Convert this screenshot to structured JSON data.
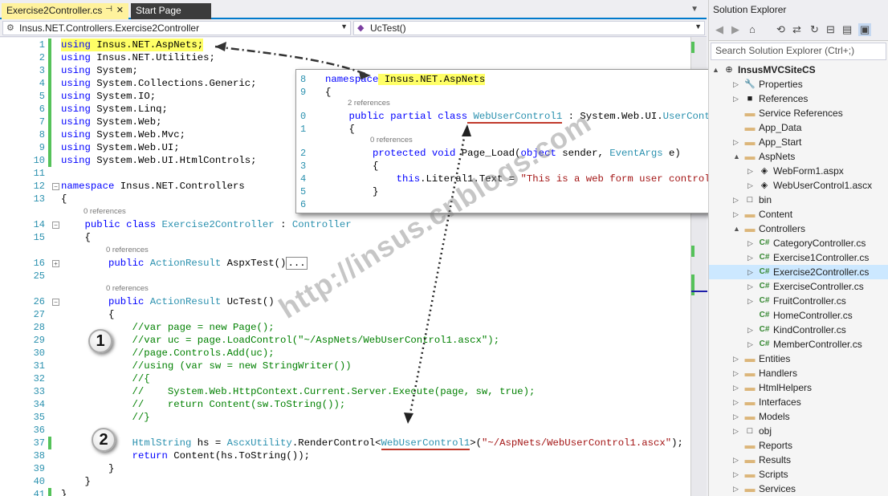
{
  "tabs": [
    {
      "label": "Exercise2Controller.cs",
      "pinned": "⊣",
      "close": "✕"
    },
    {
      "label": "Start Page"
    }
  ],
  "nav": {
    "left": "Insus.NET.Controllers.Exercise2Controller",
    "right": "UcTest()"
  },
  "code_lines": [
    {
      "n": "1",
      "t": [
        [
          "kw",
          "using"
        ],
        [
          "",
          "Insus.NET.AspNets;"
        ]
      ],
      "hl": true,
      "chg": true
    },
    {
      "n": "2",
      "t": [
        [
          "kw",
          "using"
        ],
        [
          "",
          "Insus.NET.Utilities;"
        ]
      ],
      "chg": true
    },
    {
      "n": "3",
      "t": [
        [
          "kw",
          "using"
        ],
        [
          "",
          "System;"
        ]
      ],
      "chg": true
    },
    {
      "n": "4",
      "t": [
        [
          "kw",
          "using"
        ],
        [
          "",
          "System.Collections.Generic;"
        ]
      ],
      "chg": true
    },
    {
      "n": "5",
      "t": [
        [
          "kw",
          "using"
        ],
        [
          "",
          "System.IO;"
        ]
      ],
      "chg": true
    },
    {
      "n": "6",
      "t": [
        [
          "kw",
          "using"
        ],
        [
          "",
          "System.Linq;"
        ]
      ],
      "chg": true
    },
    {
      "n": "7",
      "t": [
        [
          "kw",
          "using"
        ],
        [
          "",
          "System.Web;"
        ]
      ],
      "chg": true
    },
    {
      "n": "8",
      "t": [
        [
          "kw",
          "using"
        ],
        [
          "",
          "System.Web.Mvc;"
        ]
      ],
      "chg": true
    },
    {
      "n": "9",
      "t": [
        [
          "kw",
          "using"
        ],
        [
          "",
          "System.Web.UI;"
        ]
      ],
      "chg": true
    },
    {
      "n": "10",
      "t": [
        [
          "kw",
          "using"
        ],
        [
          "",
          "System.Web.UI.HtmlControls;"
        ]
      ],
      "chg": true
    },
    {
      "n": "11",
      "t": []
    },
    {
      "n": "12",
      "t": [
        [
          "kw",
          "namespace"
        ],
        [
          "",
          "Insus.NET.Controllers"
        ]
      ]
    },
    {
      "n": "13",
      "t": [
        [
          "",
          "{"
        ]
      ]
    },
    {
      "n": "14",
      "t": [
        [
          "",
          "    "
        ],
        [
          "kw",
          "public class"
        ],
        [
          "ty",
          "Exercise2Controller"
        ],
        [
          "",
          " : "
        ],
        [
          "ty",
          "Controller"
        ]
      ]
    },
    {
      "n": "15",
      "t": [
        [
          "",
          "    {"
        ]
      ]
    },
    {
      "n": "16",
      "t": [
        [
          "",
          "        "
        ],
        [
          "kw",
          "public"
        ],
        [
          "ty",
          "ActionResult"
        ],
        [
          "",
          "AspxTest()"
        ],
        [
          "box",
          "..."
        ]
      ]
    },
    {
      "n": "25",
      "t": []
    },
    {
      "n": "26",
      "t": [
        [
          "",
          "        "
        ],
        [
          "kw",
          "public"
        ],
        [
          "ty",
          "ActionResult"
        ],
        [
          "",
          "UcTest()"
        ]
      ]
    },
    {
      "n": "27",
      "t": [
        [
          "",
          "        {"
        ]
      ]
    },
    {
      "n": "28",
      "t": [
        [
          "cm",
          "            //var page = new Page();"
        ]
      ]
    },
    {
      "n": "29",
      "t": [
        [
          "cm",
          "            //var uc = page.LoadControl(\"~/AspNets/WebUserControl1.ascx\");"
        ]
      ]
    },
    {
      "n": "30",
      "t": [
        [
          "cm",
          "            //page.Controls.Add(uc);"
        ]
      ]
    },
    {
      "n": "31",
      "t": [
        [
          "cm",
          "            //using (var sw = new StringWriter())"
        ]
      ]
    },
    {
      "n": "32",
      "t": [
        [
          "cm",
          "            //{"
        ]
      ]
    },
    {
      "n": "33",
      "t": [
        [
          "cm",
          "            //    System.Web.HttpContext.Current.Server.Execute(page, sw, true);"
        ]
      ]
    },
    {
      "n": "34",
      "t": [
        [
          "cm",
          "            //    return Content(sw.ToString());"
        ]
      ]
    },
    {
      "n": "35",
      "t": [
        [
          "cm",
          "            //}"
        ]
      ]
    },
    {
      "n": "36",
      "t": []
    },
    {
      "n": "37",
      "t": [
        [
          "",
          "            "
        ],
        [
          "ty",
          "HtmlString"
        ],
        [
          "",
          " hs = "
        ],
        [
          "ty",
          "AscxUtility"
        ],
        [
          "",
          ".RenderControl<"
        ],
        [
          "tyu",
          "WebUserControl1"
        ],
        [
          "",
          ">("
        ],
        [
          "st",
          "\"~/AspNets/WebUserControl1.ascx\""
        ],
        [
          "",
          ");"
        ]
      ],
      "chg": true
    },
    {
      "n": "38",
      "t": [
        [
          "",
          "            "
        ],
        [
          "kw",
          "return"
        ],
        [
          "",
          " Content(hs.ToString());"
        ]
      ]
    },
    {
      "n": "39",
      "t": [
        [
          "",
          "        }"
        ]
      ]
    },
    {
      "n": "40",
      "t": [
        [
          "",
          "    }"
        ]
      ]
    },
    {
      "n": "41",
      "t": [
        [
          "",
          "}"
        ]
      ],
      "chg": true
    }
  ],
  "refs": {
    "r14": "0 references",
    "r16": "0 references",
    "r26": "0 references"
  },
  "popup": {
    "lines": [
      {
        "n": "8",
        "t": [
          [
            "kw",
            "namespace"
          ],
          [
            "hl",
            "Insus.NET.AspNets"
          ]
        ]
      },
      {
        "n": "9",
        "t": [
          [
            "",
            "{"
          ]
        ]
      },
      {
        "n": "0",
        "t": [
          [
            "",
            "    "
          ],
          [
            "kw",
            "public partial class"
          ],
          [
            "tyu",
            "WebUserControl1"
          ],
          [
            "",
            " : System.Web.UI."
          ],
          [
            "ty",
            "UserControl"
          ]
        ]
      },
      {
        "n": "1",
        "t": [
          [
            "",
            "    {"
          ]
        ]
      },
      {
        "n": "2",
        "t": [
          [
            "",
            "        "
          ],
          [
            "kw",
            "protected void"
          ],
          [
            "",
            "Page_Load("
          ],
          [
            "kw",
            "object"
          ],
          [
            "",
            " sender, "
          ],
          [
            "ty",
            "EventArgs"
          ],
          [
            "",
            " e)"
          ]
        ]
      },
      {
        "n": "3",
        "t": [
          [
            "",
            "        {"
          ]
        ]
      },
      {
        "n": "4",
        "t": [
          [
            "",
            "            "
          ],
          [
            "kw",
            "this"
          ],
          [
            "",
            ".Literal1.Text = "
          ],
          [
            "st",
            "\"This is a web form user control.\""
          ],
          [
            "",
            ";"
          ]
        ]
      },
      {
        "n": "5",
        "t": [
          [
            "",
            "        }"
          ]
        ]
      },
      {
        "n": "6",
        "t": []
      }
    ],
    "ref1": "2 references",
    "ref2": "0 references"
  },
  "watermark": "http://insus.cnblogs.com",
  "badges": [
    "1",
    "2"
  ],
  "solution_explorer": {
    "title": "Solution Explorer",
    "search_placeholder": "Search Solution Explorer (Ctrl+;)",
    "items": [
      {
        "label": "InsusMVCSiteCS",
        "depth": 0,
        "arrow": "▲",
        "icon": "⊕",
        "bold": true
      },
      {
        "label": "Properties",
        "depth": 1,
        "arrow": "▷",
        "icon": "🔧"
      },
      {
        "label": "References",
        "depth": 1,
        "arrow": "▷",
        "icon": "■"
      },
      {
        "label": "Service References",
        "depth": 1,
        "arrow": "",
        "icon": "📁"
      },
      {
        "label": "App_Data",
        "depth": 1,
        "arrow": "",
        "icon": "📁"
      },
      {
        "label": "App_Start",
        "depth": 1,
        "arrow": "▷",
        "icon": "📁"
      },
      {
        "label": "AspNets",
        "depth": 1,
        "arrow": "▲",
        "icon": "📁"
      },
      {
        "label": "WebForm1.aspx",
        "depth": 2,
        "arrow": "▷",
        "icon": "◈"
      },
      {
        "label": "WebUserControl1.ascx",
        "depth": 2,
        "arrow": "▷",
        "icon": "◈"
      },
      {
        "label": "bin",
        "depth": 1,
        "arrow": "▷",
        "icon": "□"
      },
      {
        "label": "Content",
        "depth": 1,
        "arrow": "▷",
        "icon": "📁"
      },
      {
        "label": "Controllers",
        "depth": 1,
        "arrow": "▲",
        "icon": "📁"
      },
      {
        "label": "CategoryController.cs",
        "depth": 2,
        "arrow": "▷",
        "icon": "C#"
      },
      {
        "label": "Exercise1Controller.cs",
        "depth": 2,
        "arrow": "▷",
        "icon": "C#"
      },
      {
        "label": "Exercise2Controller.cs",
        "depth": 2,
        "arrow": "▷",
        "icon": "C#",
        "sel": true
      },
      {
        "label": "ExerciseController.cs",
        "depth": 2,
        "arrow": "▷",
        "icon": "C#"
      },
      {
        "label": "FruitController.cs",
        "depth": 2,
        "arrow": "▷",
        "icon": "C#"
      },
      {
        "label": "HomeController.cs",
        "depth": 2,
        "arrow": "",
        "icon": "C#"
      },
      {
        "label": "KindController.cs",
        "depth": 2,
        "arrow": "▷",
        "icon": "C#"
      },
      {
        "label": "MemberController.cs",
        "depth": 2,
        "arrow": "▷",
        "icon": "C#"
      },
      {
        "label": "Entities",
        "depth": 1,
        "arrow": "▷",
        "icon": "📁"
      },
      {
        "label": "Handlers",
        "depth": 1,
        "arrow": "▷",
        "icon": "📁"
      },
      {
        "label": "HtmlHelpers",
        "depth": 1,
        "arrow": "▷",
        "icon": "📁"
      },
      {
        "label": "Interfaces",
        "depth": 1,
        "arrow": "▷",
        "icon": "📁"
      },
      {
        "label": "Models",
        "depth": 1,
        "arrow": "▷",
        "icon": "📁"
      },
      {
        "label": "obj",
        "depth": 1,
        "arrow": "▷",
        "icon": "□"
      },
      {
        "label": "Reports",
        "depth": 1,
        "arrow": "",
        "icon": "📁"
      },
      {
        "label": "Results",
        "depth": 1,
        "arrow": "▷",
        "icon": "📁"
      },
      {
        "label": "Scripts",
        "depth": 1,
        "arrow": "▷",
        "icon": "📁"
      },
      {
        "label": "Services",
        "depth": 1,
        "arrow": "▷",
        "icon": "📁"
      }
    ]
  },
  "colors": {
    "accent": "#007ACC",
    "keyword": "#0000FF",
    "type": "#2B91AF",
    "comment": "#008000",
    "string": "#A31515",
    "change": "#55C25A"
  }
}
